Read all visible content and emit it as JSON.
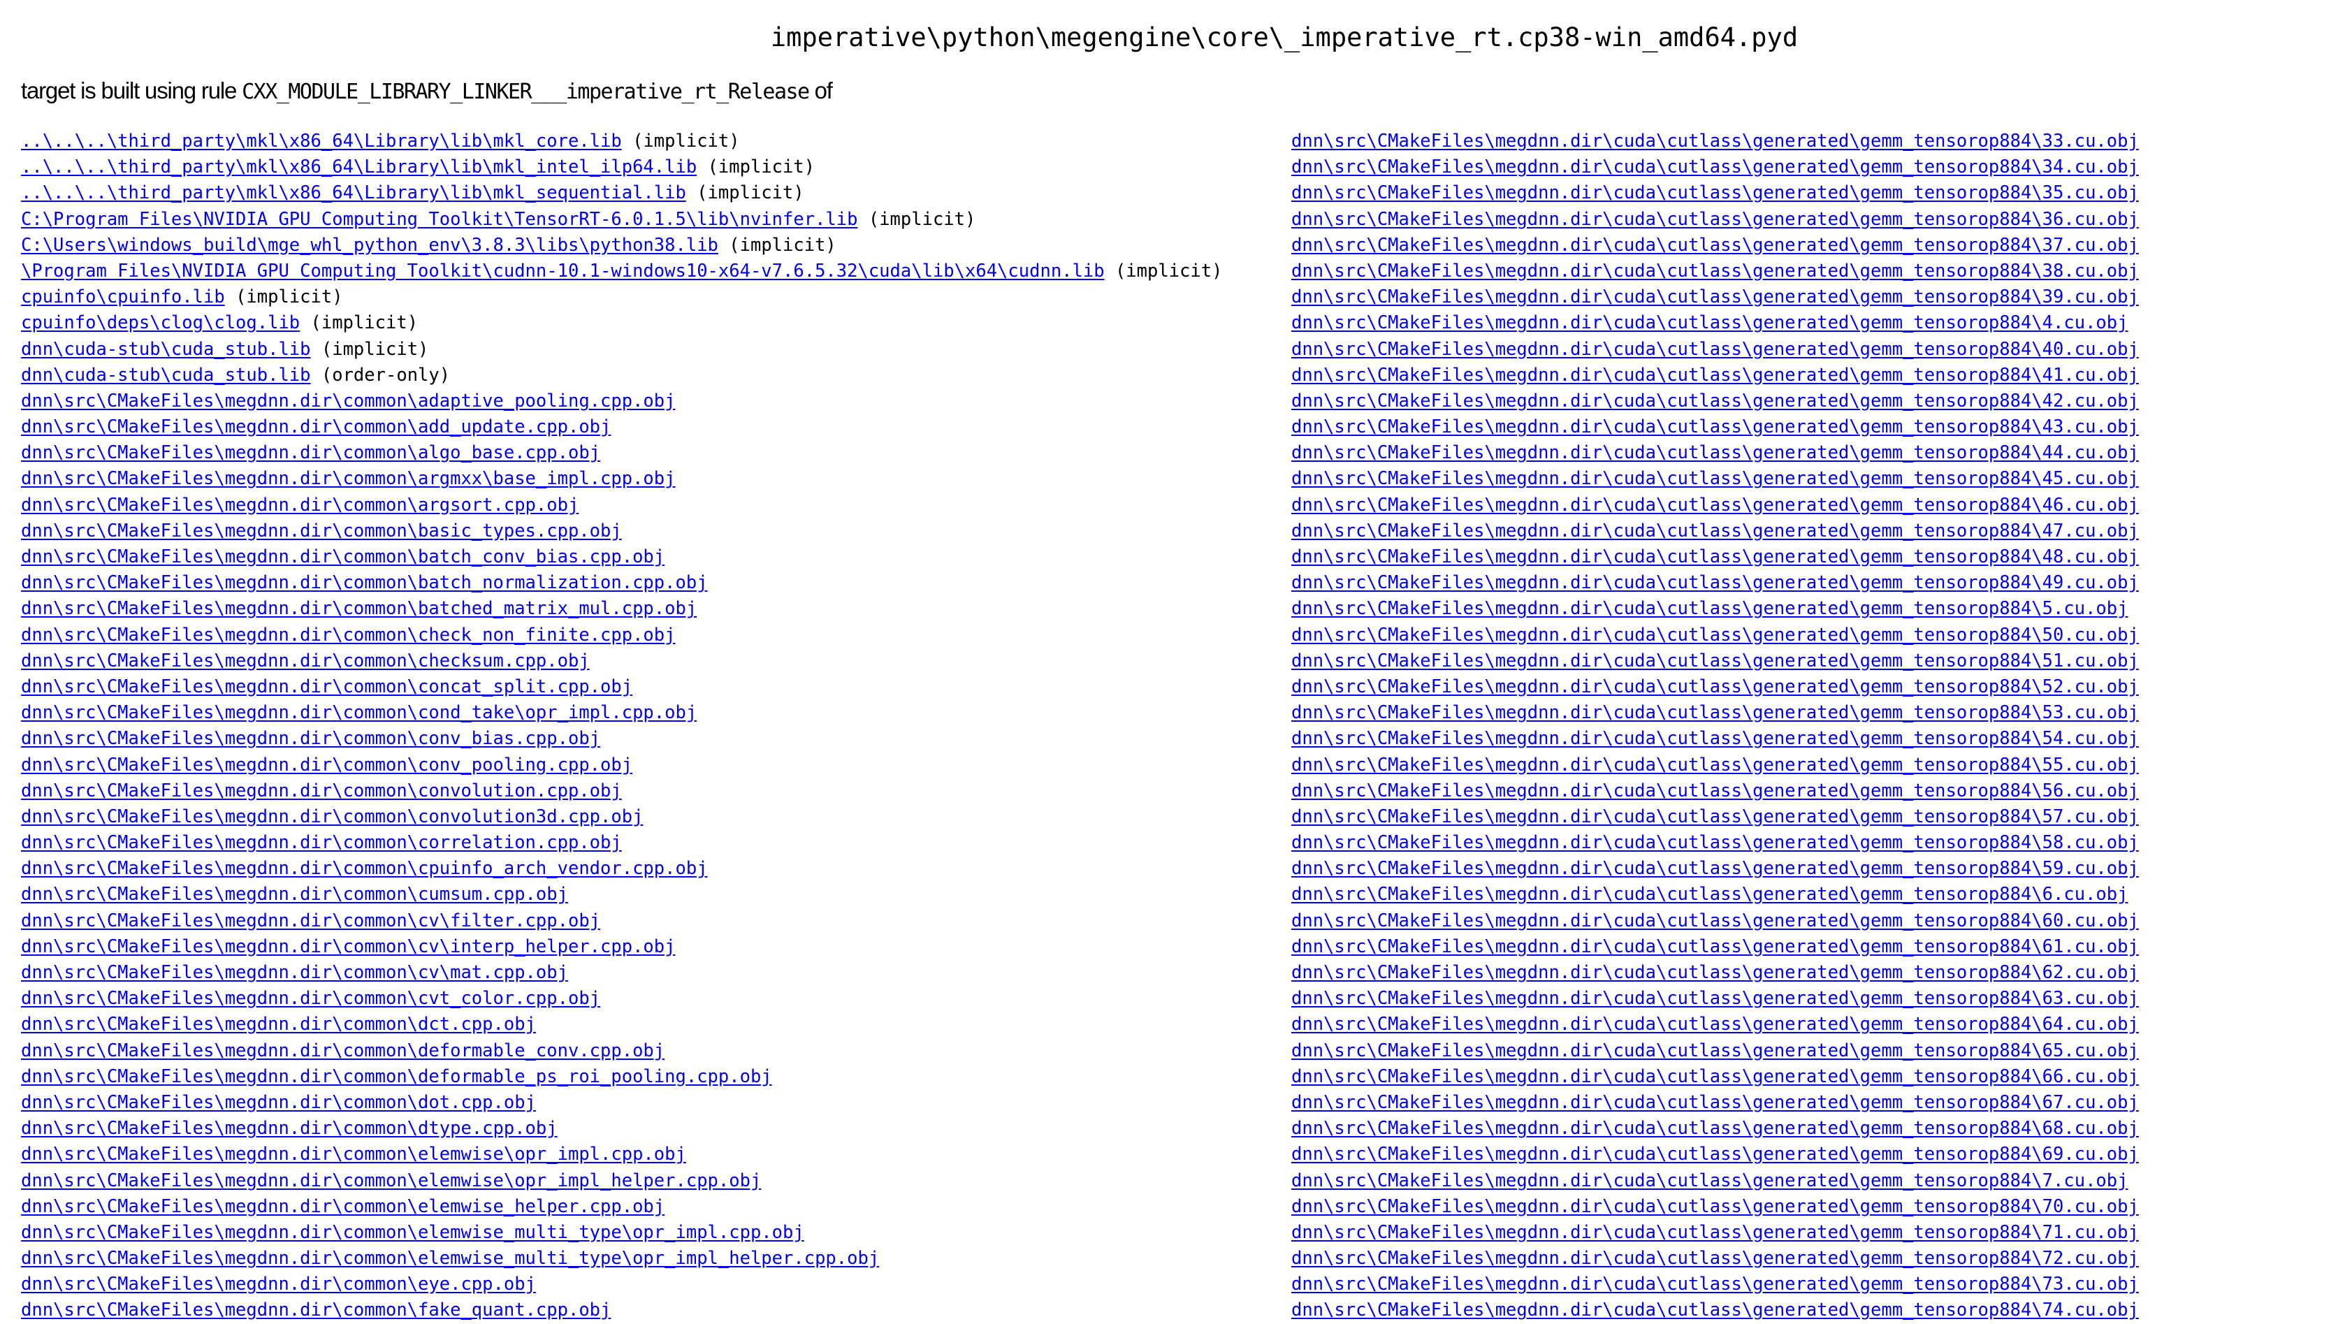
{
  "page": {
    "title": "imperative\\python\\megengine\\core\\_imperative_rt.cp38-win_amd64.pyd",
    "subtitle_prefix": "target is built using rule ",
    "rule_name": "CXX_MODULE_LIBRARY_LINKER___imperative_rt_Release",
    "subtitle_suffix": " of",
    "link_color": "#0000ee"
  },
  "inputs_left": [
    {
      "path": "..\\..\\..\\third_party\\mkl\\x86_64\\Library\\lib\\mkl_core.lib",
      "kind": "(implicit)"
    },
    {
      "path": "..\\..\\..\\third_party\\mkl\\x86_64\\Library\\lib\\mkl_intel_ilp64.lib",
      "kind": "(implicit)"
    },
    {
      "path": "..\\..\\..\\third_party\\mkl\\x86_64\\Library\\lib\\mkl_sequential.lib",
      "kind": "(implicit)"
    },
    {
      "path": "C:\\Program Files\\NVIDIA GPU Computing Toolkit\\TensorRT-6.0.1.5\\lib\\nvinfer.lib",
      "kind": "(implicit)"
    },
    {
      "path": "C:\\Users\\windows_build\\mge_whl_python_env\\3.8.3\\libs\\python38.lib",
      "kind": "(implicit)"
    },
    {
      "path": "\\Program Files\\NVIDIA GPU Computing Toolkit\\cudnn-10.1-windows10-x64-v7.6.5.32\\cuda\\lib\\x64\\cudnn.lib",
      "kind": "(implicit)"
    },
    {
      "path": "cpuinfo\\cpuinfo.lib",
      "kind": "(implicit)"
    },
    {
      "path": "cpuinfo\\deps\\clog\\clog.lib",
      "kind": "(implicit)"
    },
    {
      "path": "dnn\\cuda-stub\\cuda_stub.lib",
      "kind": "(implicit)"
    },
    {
      "path": "dnn\\cuda-stub\\cuda_stub.lib",
      "kind": "(order-only)"
    },
    {
      "path": "dnn\\src\\CMakeFiles\\megdnn.dir\\common\\adaptive_pooling.cpp.obj",
      "kind": ""
    },
    {
      "path": "dnn\\src\\CMakeFiles\\megdnn.dir\\common\\add_update.cpp.obj",
      "kind": ""
    },
    {
      "path": "dnn\\src\\CMakeFiles\\megdnn.dir\\common\\algo_base.cpp.obj",
      "kind": ""
    },
    {
      "path": "dnn\\src\\CMakeFiles\\megdnn.dir\\common\\argmxx\\base_impl.cpp.obj",
      "kind": ""
    },
    {
      "path": "dnn\\src\\CMakeFiles\\megdnn.dir\\common\\argsort.cpp.obj",
      "kind": ""
    },
    {
      "path": "dnn\\src\\CMakeFiles\\megdnn.dir\\common\\basic_types.cpp.obj",
      "kind": ""
    },
    {
      "path": "dnn\\src\\CMakeFiles\\megdnn.dir\\common\\batch_conv_bias.cpp.obj",
      "kind": ""
    },
    {
      "path": "dnn\\src\\CMakeFiles\\megdnn.dir\\common\\batch_normalization.cpp.obj",
      "kind": ""
    },
    {
      "path": "dnn\\src\\CMakeFiles\\megdnn.dir\\common\\batched_matrix_mul.cpp.obj",
      "kind": ""
    },
    {
      "path": "dnn\\src\\CMakeFiles\\megdnn.dir\\common\\check_non_finite.cpp.obj",
      "kind": ""
    },
    {
      "path": "dnn\\src\\CMakeFiles\\megdnn.dir\\common\\checksum.cpp.obj",
      "kind": ""
    },
    {
      "path": "dnn\\src\\CMakeFiles\\megdnn.dir\\common\\concat_split.cpp.obj",
      "kind": ""
    },
    {
      "path": "dnn\\src\\CMakeFiles\\megdnn.dir\\common\\cond_take\\opr_impl.cpp.obj",
      "kind": ""
    },
    {
      "path": "dnn\\src\\CMakeFiles\\megdnn.dir\\common\\conv_bias.cpp.obj",
      "kind": ""
    },
    {
      "path": "dnn\\src\\CMakeFiles\\megdnn.dir\\common\\conv_pooling.cpp.obj",
      "kind": ""
    },
    {
      "path": "dnn\\src\\CMakeFiles\\megdnn.dir\\common\\convolution.cpp.obj",
      "kind": ""
    },
    {
      "path": "dnn\\src\\CMakeFiles\\megdnn.dir\\common\\convolution3d.cpp.obj",
      "kind": ""
    },
    {
      "path": "dnn\\src\\CMakeFiles\\megdnn.dir\\common\\correlation.cpp.obj",
      "kind": ""
    },
    {
      "path": "dnn\\src\\CMakeFiles\\megdnn.dir\\common\\cpuinfo_arch_vendor.cpp.obj",
      "kind": ""
    },
    {
      "path": "dnn\\src\\CMakeFiles\\megdnn.dir\\common\\cumsum.cpp.obj",
      "kind": ""
    },
    {
      "path": "dnn\\src\\CMakeFiles\\megdnn.dir\\common\\cv\\filter.cpp.obj",
      "kind": ""
    },
    {
      "path": "dnn\\src\\CMakeFiles\\megdnn.dir\\common\\cv\\interp_helper.cpp.obj",
      "kind": ""
    },
    {
      "path": "dnn\\src\\CMakeFiles\\megdnn.dir\\common\\cv\\mat.cpp.obj",
      "kind": ""
    },
    {
      "path": "dnn\\src\\CMakeFiles\\megdnn.dir\\common\\cvt_color.cpp.obj",
      "kind": ""
    },
    {
      "path": "dnn\\src\\CMakeFiles\\megdnn.dir\\common\\dct.cpp.obj",
      "kind": ""
    },
    {
      "path": "dnn\\src\\CMakeFiles\\megdnn.dir\\common\\deformable_conv.cpp.obj",
      "kind": ""
    },
    {
      "path": "dnn\\src\\CMakeFiles\\megdnn.dir\\common\\deformable_ps_roi_pooling.cpp.obj",
      "kind": ""
    },
    {
      "path": "dnn\\src\\CMakeFiles\\megdnn.dir\\common\\dot.cpp.obj",
      "kind": ""
    },
    {
      "path": "dnn\\src\\CMakeFiles\\megdnn.dir\\common\\dtype.cpp.obj",
      "kind": ""
    },
    {
      "path": "dnn\\src\\CMakeFiles\\megdnn.dir\\common\\elemwise\\opr_impl.cpp.obj",
      "kind": ""
    },
    {
      "path": "dnn\\src\\CMakeFiles\\megdnn.dir\\common\\elemwise\\opr_impl_helper.cpp.obj",
      "kind": ""
    },
    {
      "path": "dnn\\src\\CMakeFiles\\megdnn.dir\\common\\elemwise_helper.cpp.obj",
      "kind": ""
    },
    {
      "path": "dnn\\src\\CMakeFiles\\megdnn.dir\\common\\elemwise_multi_type\\opr_impl.cpp.obj",
      "kind": ""
    },
    {
      "path": "dnn\\src\\CMakeFiles\\megdnn.dir\\common\\elemwise_multi_type\\opr_impl_helper.cpp.obj",
      "kind": ""
    },
    {
      "path": "dnn\\src\\CMakeFiles\\megdnn.dir\\common\\eye.cpp.obj",
      "kind": ""
    },
    {
      "path": "dnn\\src\\CMakeFiles\\megdnn.dir\\common\\fake_quant.cpp.obj",
      "kind": ""
    }
  ],
  "inputs_right": [
    {
      "path": "dnn\\src\\CMakeFiles\\megdnn.dir\\cuda\\cutlass\\generated\\gemm_tensorop884\\33.cu.obj",
      "kind": ""
    },
    {
      "path": "dnn\\src\\CMakeFiles\\megdnn.dir\\cuda\\cutlass\\generated\\gemm_tensorop884\\34.cu.obj",
      "kind": ""
    },
    {
      "path": "dnn\\src\\CMakeFiles\\megdnn.dir\\cuda\\cutlass\\generated\\gemm_tensorop884\\35.cu.obj",
      "kind": ""
    },
    {
      "path": "dnn\\src\\CMakeFiles\\megdnn.dir\\cuda\\cutlass\\generated\\gemm_tensorop884\\36.cu.obj",
      "kind": ""
    },
    {
      "path": "dnn\\src\\CMakeFiles\\megdnn.dir\\cuda\\cutlass\\generated\\gemm_tensorop884\\37.cu.obj",
      "kind": ""
    },
    {
      "path": "dnn\\src\\CMakeFiles\\megdnn.dir\\cuda\\cutlass\\generated\\gemm_tensorop884\\38.cu.obj",
      "kind": ""
    },
    {
      "path": "dnn\\src\\CMakeFiles\\megdnn.dir\\cuda\\cutlass\\generated\\gemm_tensorop884\\39.cu.obj",
      "kind": ""
    },
    {
      "path": "dnn\\src\\CMakeFiles\\megdnn.dir\\cuda\\cutlass\\generated\\gemm_tensorop884\\4.cu.obj",
      "kind": ""
    },
    {
      "path": "dnn\\src\\CMakeFiles\\megdnn.dir\\cuda\\cutlass\\generated\\gemm_tensorop884\\40.cu.obj",
      "kind": ""
    },
    {
      "path": "dnn\\src\\CMakeFiles\\megdnn.dir\\cuda\\cutlass\\generated\\gemm_tensorop884\\41.cu.obj",
      "kind": ""
    },
    {
      "path": "dnn\\src\\CMakeFiles\\megdnn.dir\\cuda\\cutlass\\generated\\gemm_tensorop884\\42.cu.obj",
      "kind": ""
    },
    {
      "path": "dnn\\src\\CMakeFiles\\megdnn.dir\\cuda\\cutlass\\generated\\gemm_tensorop884\\43.cu.obj",
      "kind": ""
    },
    {
      "path": "dnn\\src\\CMakeFiles\\megdnn.dir\\cuda\\cutlass\\generated\\gemm_tensorop884\\44.cu.obj",
      "kind": ""
    },
    {
      "path": "dnn\\src\\CMakeFiles\\megdnn.dir\\cuda\\cutlass\\generated\\gemm_tensorop884\\45.cu.obj",
      "kind": ""
    },
    {
      "path": "dnn\\src\\CMakeFiles\\megdnn.dir\\cuda\\cutlass\\generated\\gemm_tensorop884\\46.cu.obj",
      "kind": ""
    },
    {
      "path": "dnn\\src\\CMakeFiles\\megdnn.dir\\cuda\\cutlass\\generated\\gemm_tensorop884\\47.cu.obj",
      "kind": ""
    },
    {
      "path": "dnn\\src\\CMakeFiles\\megdnn.dir\\cuda\\cutlass\\generated\\gemm_tensorop884\\48.cu.obj",
      "kind": ""
    },
    {
      "path": "dnn\\src\\CMakeFiles\\megdnn.dir\\cuda\\cutlass\\generated\\gemm_tensorop884\\49.cu.obj",
      "kind": ""
    },
    {
      "path": "dnn\\src\\CMakeFiles\\megdnn.dir\\cuda\\cutlass\\generated\\gemm_tensorop884\\5.cu.obj",
      "kind": ""
    },
    {
      "path": "dnn\\src\\CMakeFiles\\megdnn.dir\\cuda\\cutlass\\generated\\gemm_tensorop884\\50.cu.obj",
      "kind": ""
    },
    {
      "path": "dnn\\src\\CMakeFiles\\megdnn.dir\\cuda\\cutlass\\generated\\gemm_tensorop884\\51.cu.obj",
      "kind": ""
    },
    {
      "path": "dnn\\src\\CMakeFiles\\megdnn.dir\\cuda\\cutlass\\generated\\gemm_tensorop884\\52.cu.obj",
      "kind": ""
    },
    {
      "path": "dnn\\src\\CMakeFiles\\megdnn.dir\\cuda\\cutlass\\generated\\gemm_tensorop884\\53.cu.obj",
      "kind": ""
    },
    {
      "path": "dnn\\src\\CMakeFiles\\megdnn.dir\\cuda\\cutlass\\generated\\gemm_tensorop884\\54.cu.obj",
      "kind": ""
    },
    {
      "path": "dnn\\src\\CMakeFiles\\megdnn.dir\\cuda\\cutlass\\generated\\gemm_tensorop884\\55.cu.obj",
      "kind": ""
    },
    {
      "path": "dnn\\src\\CMakeFiles\\megdnn.dir\\cuda\\cutlass\\generated\\gemm_tensorop884\\56.cu.obj",
      "kind": ""
    },
    {
      "path": "dnn\\src\\CMakeFiles\\megdnn.dir\\cuda\\cutlass\\generated\\gemm_tensorop884\\57.cu.obj",
      "kind": ""
    },
    {
      "path": "dnn\\src\\CMakeFiles\\megdnn.dir\\cuda\\cutlass\\generated\\gemm_tensorop884\\58.cu.obj",
      "kind": ""
    },
    {
      "path": "dnn\\src\\CMakeFiles\\megdnn.dir\\cuda\\cutlass\\generated\\gemm_tensorop884\\59.cu.obj",
      "kind": ""
    },
    {
      "path": "dnn\\src\\CMakeFiles\\megdnn.dir\\cuda\\cutlass\\generated\\gemm_tensorop884\\6.cu.obj",
      "kind": ""
    },
    {
      "path": "dnn\\src\\CMakeFiles\\megdnn.dir\\cuda\\cutlass\\generated\\gemm_tensorop884\\60.cu.obj",
      "kind": ""
    },
    {
      "path": "dnn\\src\\CMakeFiles\\megdnn.dir\\cuda\\cutlass\\generated\\gemm_tensorop884\\61.cu.obj",
      "kind": ""
    },
    {
      "path": "dnn\\src\\CMakeFiles\\megdnn.dir\\cuda\\cutlass\\generated\\gemm_tensorop884\\62.cu.obj",
      "kind": ""
    },
    {
      "path": "dnn\\src\\CMakeFiles\\megdnn.dir\\cuda\\cutlass\\generated\\gemm_tensorop884\\63.cu.obj",
      "kind": ""
    },
    {
      "path": "dnn\\src\\CMakeFiles\\megdnn.dir\\cuda\\cutlass\\generated\\gemm_tensorop884\\64.cu.obj",
      "kind": ""
    },
    {
      "path": "dnn\\src\\CMakeFiles\\megdnn.dir\\cuda\\cutlass\\generated\\gemm_tensorop884\\65.cu.obj",
      "kind": ""
    },
    {
      "path": "dnn\\src\\CMakeFiles\\megdnn.dir\\cuda\\cutlass\\generated\\gemm_tensorop884\\66.cu.obj",
      "kind": ""
    },
    {
      "path": "dnn\\src\\CMakeFiles\\megdnn.dir\\cuda\\cutlass\\generated\\gemm_tensorop884\\67.cu.obj",
      "kind": ""
    },
    {
      "path": "dnn\\src\\CMakeFiles\\megdnn.dir\\cuda\\cutlass\\generated\\gemm_tensorop884\\68.cu.obj",
      "kind": ""
    },
    {
      "path": "dnn\\src\\CMakeFiles\\megdnn.dir\\cuda\\cutlass\\generated\\gemm_tensorop884\\69.cu.obj",
      "kind": ""
    },
    {
      "path": "dnn\\src\\CMakeFiles\\megdnn.dir\\cuda\\cutlass\\generated\\gemm_tensorop884\\7.cu.obj",
      "kind": ""
    },
    {
      "path": "dnn\\src\\CMakeFiles\\megdnn.dir\\cuda\\cutlass\\generated\\gemm_tensorop884\\70.cu.obj",
      "kind": ""
    },
    {
      "path": "dnn\\src\\CMakeFiles\\megdnn.dir\\cuda\\cutlass\\generated\\gemm_tensorop884\\71.cu.obj",
      "kind": ""
    },
    {
      "path": "dnn\\src\\CMakeFiles\\megdnn.dir\\cuda\\cutlass\\generated\\gemm_tensorop884\\72.cu.obj",
      "kind": ""
    },
    {
      "path": "dnn\\src\\CMakeFiles\\megdnn.dir\\cuda\\cutlass\\generated\\gemm_tensorop884\\73.cu.obj",
      "kind": ""
    },
    {
      "path": "dnn\\src\\CMakeFiles\\megdnn.dir\\cuda\\cutlass\\generated\\gemm_tensorop884\\74.cu.obj",
      "kind": ""
    }
  ]
}
